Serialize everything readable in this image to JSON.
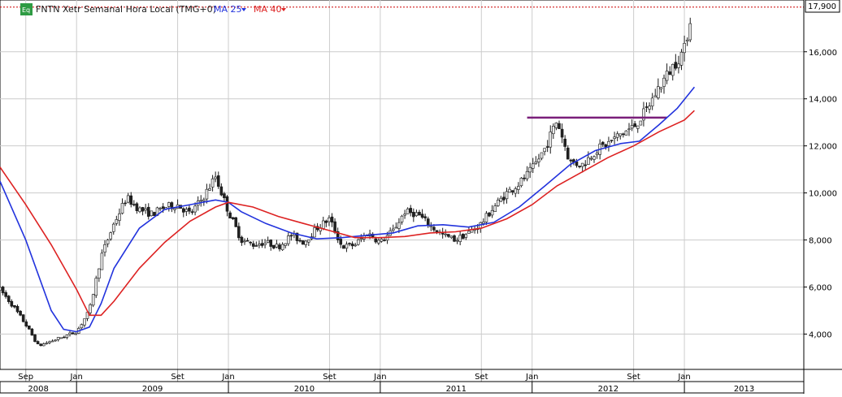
{
  "header": {
    "badge": "Eq",
    "instrument": "FNTN Xetr Semanal Hora Local (TMG+0)",
    "ma_fast_label": "MA 25",
    "ma_slow_label": "MA 40",
    "last_price_tag": "17,900"
  },
  "chart_data": {
    "type": "candlestick",
    "title": "FNTN Xetr Semanal Hora Local (TMG+0)",
    "xlabel": "",
    "ylabel": "",
    "ylim": [
      2500,
      18200
    ],
    "grid": true,
    "y_ticks": [
      4000,
      6000,
      8000,
      10000,
      12000,
      14000,
      16000
    ],
    "y_tick_labels": [
      "4,000",
      "6,000",
      "8,000",
      "10,000",
      "12,000",
      "14,000",
      "16,000"
    ],
    "last_price": 17900,
    "x_range": [
      "2008-07-01",
      "2013-10-15"
    ],
    "x_months": [
      {
        "label": "Sep",
        "date": "2008-09-01"
      },
      {
        "label": "Jan",
        "date": "2009-01-01"
      },
      {
        "label": "Set",
        "date": "2009-09-01"
      },
      {
        "label": "Jan",
        "date": "2010-01-01"
      },
      {
        "label": "Set",
        "date": "2010-09-01"
      },
      {
        "label": "Jan",
        "date": "2011-01-01"
      },
      {
        "label": "Set",
        "date": "2011-09-01"
      },
      {
        "label": "Jan",
        "date": "2012-01-01"
      },
      {
        "label": "Set",
        "date": "2012-09-01"
      },
      {
        "label": "Jan",
        "date": "2013-01-01"
      }
    ],
    "x_years": [
      {
        "label": "2008",
        "from": "2008-07-01",
        "to": "2009-01-01"
      },
      {
        "label": "2009",
        "from": "2009-01-01",
        "to": "2010-01-01"
      },
      {
        "label": "2010",
        "from": "2010-01-01",
        "to": "2011-01-01"
      },
      {
        "label": "2011",
        "from": "2011-01-01",
        "to": "2012-01-01"
      },
      {
        "label": "2012",
        "from": "2012-01-01",
        "to": "2013-01-01"
      },
      {
        "label": "2013",
        "from": "2013-01-01",
        "to": "2013-10-15"
      }
    ],
    "price_path": [
      [
        "2008-07-01",
        5900
      ],
      [
        "2008-08-01",
        5200
      ],
      [
        "2008-09-01",
        4400
      ],
      [
        "2008-10-01",
        3500
      ],
      [
        "2008-11-01",
        3700
      ],
      [
        "2008-12-01",
        3900
      ],
      [
        "2009-01-01",
        4100
      ],
      [
        "2009-02-01",
        5000
      ],
      [
        "2009-03-01",
        7300
      ],
      [
        "2009-04-01",
        8700
      ],
      [
        "2009-05-01",
        9800
      ],
      [
        "2009-06-01",
        9300
      ],
      [
        "2009-07-01",
        9100
      ],
      [
        "2009-08-01",
        9400
      ],
      [
        "2009-09-01",
        9500
      ],
      [
        "2009-10-01",
        9100
      ],
      [
        "2009-11-01",
        9800
      ],
      [
        "2009-12-01",
        10700
      ],
      [
        "2010-01-01",
        9200
      ],
      [
        "2010-02-01",
        8000
      ],
      [
        "2010-03-01",
        7800
      ],
      [
        "2010-04-01",
        7900
      ],
      [
        "2010-05-01",
        7700
      ],
      [
        "2010-06-01",
        8200
      ],
      [
        "2010-07-01",
        7900
      ],
      [
        "2010-08-01",
        8500
      ],
      [
        "2010-09-01",
        8900
      ],
      [
        "2010-10-01",
        7700
      ],
      [
        "2010-11-01",
        7800
      ],
      [
        "2010-12-01",
        8300
      ],
      [
        "2011-01-01",
        7900
      ],
      [
        "2011-02-01",
        8400
      ],
      [
        "2011-03-01",
        9200
      ],
      [
        "2011-04-01",
        9100
      ],
      [
        "2011-05-01",
        8600
      ],
      [
        "2011-06-01",
        8200
      ],
      [
        "2011-07-01",
        8000
      ],
      [
        "2011-08-01",
        8300
      ],
      [
        "2011-09-01",
        8700
      ],
      [
        "2011-10-01",
        9400
      ],
      [
        "2011-11-01",
        10000
      ],
      [
        "2011-12-01",
        10400
      ],
      [
        "2012-01-01",
        11000
      ],
      [
        "2012-02-01",
        11900
      ],
      [
        "2012-03-01",
        13100
      ],
      [
        "2012-04-01",
        11300
      ],
      [
        "2012-05-01",
        11200
      ],
      [
        "2012-06-01",
        11800
      ],
      [
        "2012-07-01",
        12100
      ],
      [
        "2012-08-01",
        12500
      ],
      [
        "2012-09-01",
        12800
      ],
      [
        "2012-10-01",
        13500
      ],
      [
        "2012-11-01",
        14500
      ],
      [
        "2012-12-01",
        15300
      ],
      [
        "2013-01-01",
        16100
      ],
      [
        "2013-01-20",
        17900
      ]
    ],
    "series": [
      {
        "name": "MA 25",
        "color": "#2233dd",
        "points": [
          [
            "2008-07-01",
            10500
          ],
          [
            "2008-09-01",
            8000
          ],
          [
            "2008-11-01",
            5000
          ],
          [
            "2008-12-01",
            4200
          ],
          [
            "2009-01-01",
            4100
          ],
          [
            "2009-02-01",
            4300
          ],
          [
            "2009-03-01",
            5300
          ],
          [
            "2009-04-01",
            6800
          ],
          [
            "2009-06-01",
            8500
          ],
          [
            "2009-08-01",
            9300
          ],
          [
            "2009-10-01",
            9500
          ],
          [
            "2009-12-01",
            9700
          ],
          [
            "2010-01-01",
            9600
          ],
          [
            "2010-02-01",
            9200
          ],
          [
            "2010-04-01",
            8700
          ],
          [
            "2010-06-01",
            8300
          ],
          [
            "2010-08-01",
            8050
          ],
          [
            "2010-10-01",
            8100
          ],
          [
            "2010-12-01",
            8200
          ],
          [
            "2011-02-01",
            8300
          ],
          [
            "2011-04-01",
            8600
          ],
          [
            "2011-06-01",
            8650
          ],
          [
            "2011-08-01",
            8550
          ],
          [
            "2011-10-01",
            8750
          ],
          [
            "2011-12-01",
            9400
          ],
          [
            "2012-02-01",
            10300
          ],
          [
            "2012-04-01",
            11200
          ],
          [
            "2012-06-01",
            11800
          ],
          [
            "2012-08-01",
            12100
          ],
          [
            "2012-09-15",
            12200
          ],
          [
            "2012-11-01",
            12900
          ],
          [
            "2012-12-15",
            13600
          ],
          [
            "2013-01-25",
            14500
          ]
        ]
      },
      {
        "name": "MA 40",
        "color": "#dd2222",
        "points": [
          [
            "2008-07-01",
            11100
          ],
          [
            "2008-09-01",
            9500
          ],
          [
            "2008-11-01",
            7800
          ],
          [
            "2009-01-01",
            5900
          ],
          [
            "2009-02-01",
            4800
          ],
          [
            "2009-03-01",
            4800
          ],
          [
            "2009-04-01",
            5400
          ],
          [
            "2009-06-01",
            6800
          ],
          [
            "2009-08-01",
            7900
          ],
          [
            "2009-10-01",
            8800
          ],
          [
            "2009-12-01",
            9400
          ],
          [
            "2010-01-01",
            9600
          ],
          [
            "2010-03-01",
            9400
          ],
          [
            "2010-05-01",
            9000
          ],
          [
            "2010-07-01",
            8700
          ],
          [
            "2010-09-01",
            8400
          ],
          [
            "2010-11-01",
            8100
          ],
          [
            "2011-01-01",
            8100
          ],
          [
            "2011-03-01",
            8150
          ],
          [
            "2011-05-01",
            8300
          ],
          [
            "2011-07-01",
            8350
          ],
          [
            "2011-09-01",
            8500
          ],
          [
            "2011-11-01",
            8900
          ],
          [
            "2012-01-01",
            9500
          ],
          [
            "2012-03-01",
            10300
          ],
          [
            "2012-05-01",
            10900
          ],
          [
            "2012-07-01",
            11500
          ],
          [
            "2012-09-01",
            12000
          ],
          [
            "2012-11-01",
            12600
          ],
          [
            "2013-01-01",
            13100
          ],
          [
            "2013-01-25",
            13500
          ]
        ]
      }
    ],
    "annotations": [
      {
        "type": "hline",
        "color": "#7a1f7a",
        "y": 13200,
        "from": "2011-12-20",
        "to": "2012-11-20"
      }
    ]
  }
}
